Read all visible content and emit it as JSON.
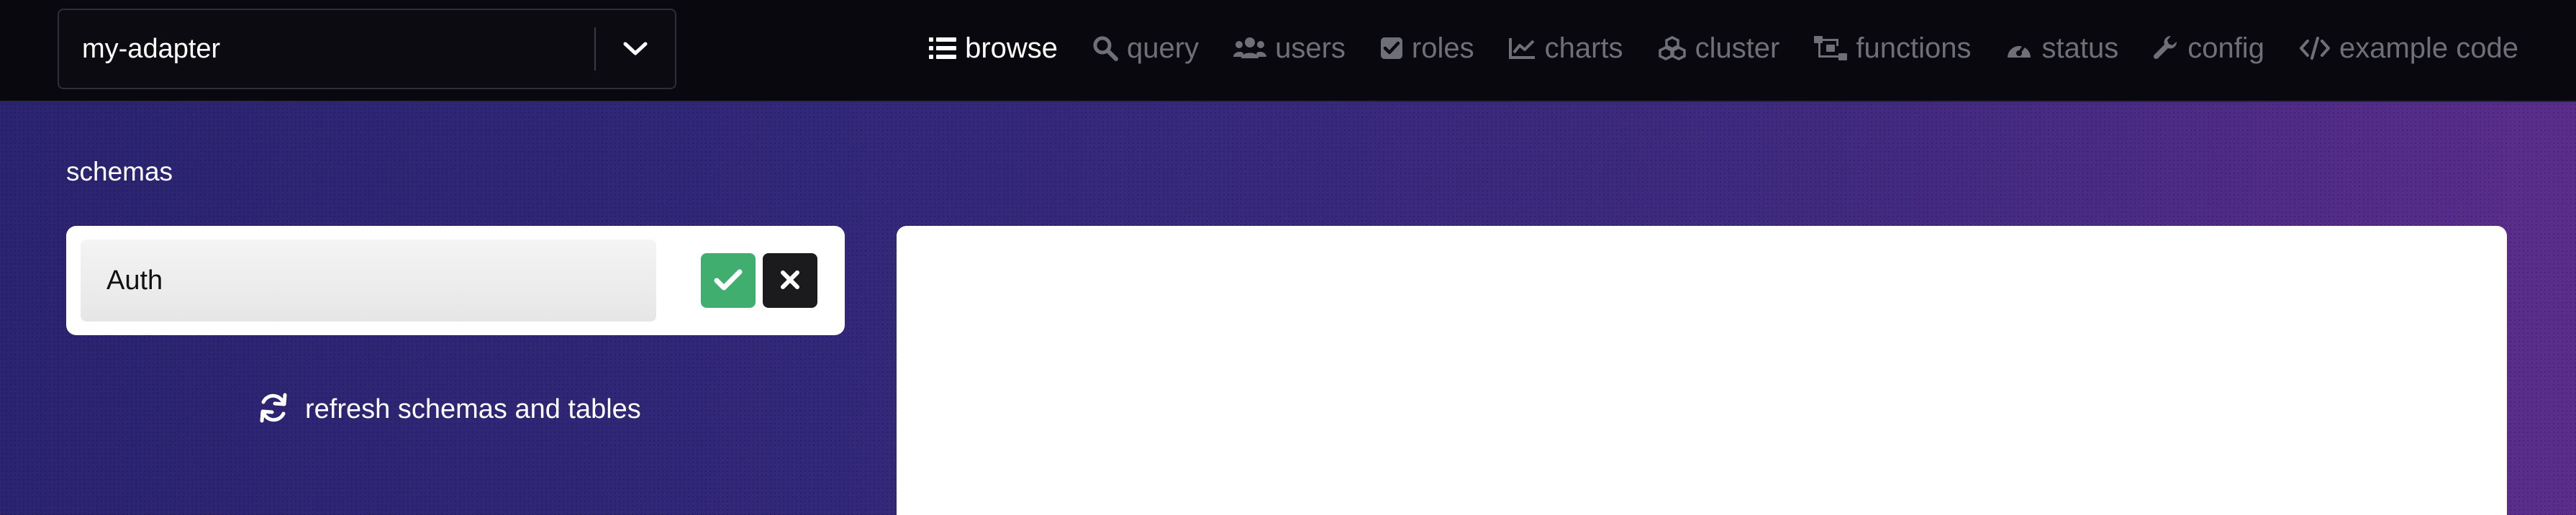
{
  "header": {
    "instance_select": {
      "value": "my-adapter"
    },
    "nav": [
      {
        "label": "browse",
        "icon": "list-icon",
        "active": true
      },
      {
        "label": "query",
        "icon": "search-icon",
        "active": false
      },
      {
        "label": "users",
        "icon": "users-icon",
        "active": false
      },
      {
        "label": "roles",
        "icon": "checkbox-icon",
        "active": false
      },
      {
        "label": "charts",
        "icon": "line-chart-icon",
        "active": false
      },
      {
        "label": "cluster",
        "icon": "cubes-icon",
        "active": false
      },
      {
        "label": "functions",
        "icon": "sitemap-icon",
        "active": false
      },
      {
        "label": "status",
        "icon": "gauge-icon",
        "active": false
      },
      {
        "label": "config",
        "icon": "wrench-icon",
        "active": false
      },
      {
        "label": "example code",
        "icon": "code-icon",
        "active": false
      }
    ]
  },
  "sidebar": {
    "title": "schemas",
    "schema_input": {
      "value": "Auth"
    },
    "refresh_label": "refresh schemas and tables"
  },
  "colors": {
    "topbar": "#09080e",
    "confirm": "#3fae6e",
    "cancel": "#1b1b1e",
    "nav_active": "#ffffff",
    "nav_inactive": "#6f6f78"
  }
}
